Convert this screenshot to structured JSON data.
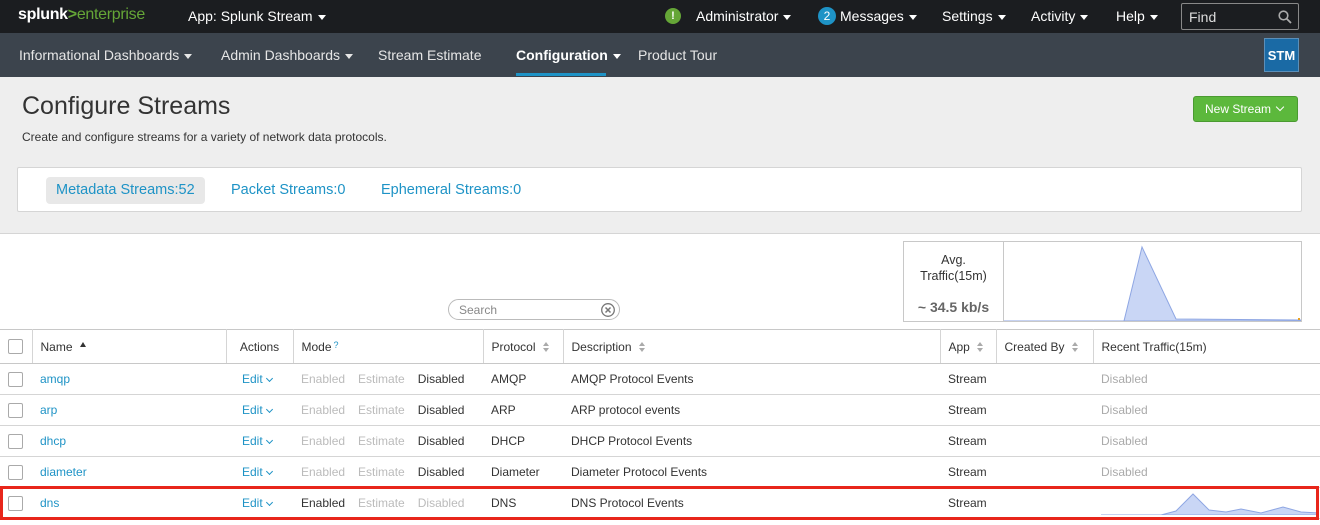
{
  "topbar": {
    "logo_main": "splunk",
    "logo_sep": ">",
    "logo_suffix": "enterprise",
    "app": "App: Splunk Stream",
    "user": "Administrator",
    "messages_count": "2",
    "messages": "Messages",
    "settings": "Settings",
    "activity": "Activity",
    "help": "Help",
    "find_placeholder": "Find"
  },
  "navbar": {
    "items": [
      "Informational Dashboards",
      "Admin Dashboards",
      "Stream Estimate",
      "Configuration",
      "Product Tour"
    ],
    "active": "Configuration",
    "app_badge": "STM"
  },
  "page": {
    "title": "Configure Streams",
    "subtitle": "Create and configure streams for a variety of network data protocols.",
    "new_stream_button": "New Stream"
  },
  "stream_tabs": [
    {
      "label": "Metadata Streams:52",
      "active": true
    },
    {
      "label": "Packet Streams:0",
      "active": false
    },
    {
      "label": "Ephemeral Streams:0",
      "active": false
    }
  ],
  "traffic": {
    "label_line1": "Avg.",
    "label_line2": "Traffic(15m)",
    "value": "~ 34.5 kb/s"
  },
  "search": {
    "placeholder": "Search"
  },
  "table": {
    "headers": {
      "name": "Name",
      "actions": "Actions",
      "mode": "Mode",
      "mode_help": "?",
      "protocol": "Protocol",
      "description": "Description",
      "app": "App",
      "created_by": "Created By",
      "recent_traffic": "Recent Traffic(15m)"
    },
    "mode_options": [
      "Enabled",
      "Estimate",
      "Disabled"
    ],
    "edit_label": "Edit",
    "rows": [
      {
        "name": "amqp",
        "mode": "Disabled",
        "protocol": "AMQP",
        "description": "AMQP Protocol Events",
        "app": "Stream",
        "created_by": "",
        "recent_traffic": "Disabled"
      },
      {
        "name": "arp",
        "mode": "Disabled",
        "protocol": "ARP",
        "description": "ARP protocol events",
        "app": "Stream",
        "created_by": "",
        "recent_traffic": "Disabled"
      },
      {
        "name": "dhcp",
        "mode": "Disabled",
        "protocol": "DHCP",
        "description": "DHCP Protocol Events",
        "app": "Stream",
        "created_by": "",
        "recent_traffic": "Disabled"
      },
      {
        "name": "diameter",
        "mode": "Disabled",
        "protocol": "Diameter",
        "description": "Diameter Protocol Events",
        "app": "Stream",
        "created_by": "",
        "recent_traffic": "Disabled"
      },
      {
        "name": "dns",
        "mode": "Enabled",
        "protocol": "DNS",
        "description": "DNS Protocol Events",
        "app": "Stream",
        "created_by": "",
        "recent_traffic": ""
      }
    ]
  },
  "colors": {
    "accent": "#1e93c6",
    "new_stream": "#5cb83c",
    "highlight": "#e8261b",
    "sparkline_fill": "#c9d6f5",
    "sparkline_stroke": "#8ea6e3"
  }
}
